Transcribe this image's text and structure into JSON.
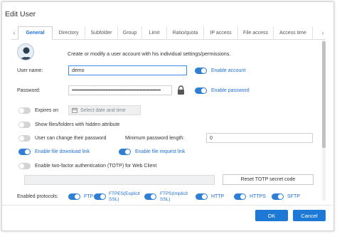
{
  "dialog": {
    "title": "Edit User"
  },
  "tabs": [
    "General",
    "Directory",
    "Subfolder",
    "Group",
    "Limit",
    "Ratio/quota",
    "IP access",
    "File access",
    "Access time"
  ],
  "icons": {
    "tab_left": "chevron-left-icon",
    "tab_right": "chevron-right-icon",
    "avatar": "user-avatar-icon",
    "calendar": "calendar-icon",
    "lock": "lock-icon"
  },
  "general": {
    "description": "Create or modify a user account with his individual settings/permissions.",
    "username_label": "User name:",
    "username_value": "demo",
    "enable_account": {
      "label": "Enable account",
      "on": true
    },
    "password_label": "Password:",
    "password_value": "••••••••••••••••••••••••••••••••••••••••••••••••••••••••••••••••",
    "enable_password": {
      "label": "Enable password",
      "on": true
    },
    "expires_on": {
      "label": "Expires on",
      "on": false
    },
    "date_placeholder": "Select date and time",
    "show_hidden": {
      "label": "Show files/folders with hidden attribute",
      "on": false
    },
    "change_password": {
      "label": "User can change their password",
      "on": false
    },
    "min_pw_label": "Minimum password length:",
    "min_pw_value": "0",
    "file_download": {
      "label": "Enable file download link",
      "on": true
    },
    "file_request": {
      "label": "Enable file request link",
      "on": true
    },
    "two_factor": {
      "label": "Enable two-factor authentication (TOTP) for Web Client",
      "on": false
    },
    "totp_value": "",
    "reset_totp": "Reset TOTP secret code",
    "protocols_label": "Enabled protocols:",
    "protocols": [
      {
        "label": "FTP",
        "on": true
      },
      {
        "label": "FTPES(Explicit SSL)",
        "on": true
      },
      {
        "label": "FTPS(Implicit SSL)",
        "on": true
      },
      {
        "label": "HTTP",
        "on": true
      },
      {
        "label": "HTTPS",
        "on": true
      },
      {
        "label": "SFTP",
        "on": true
      }
    ]
  },
  "footer": {
    "ok": "OK",
    "cancel": "Cancel"
  },
  "colors": {
    "accent": "#1e79d6",
    "toggle_off": "#d4d4d4",
    "tab_active": "#1e6fd9"
  }
}
